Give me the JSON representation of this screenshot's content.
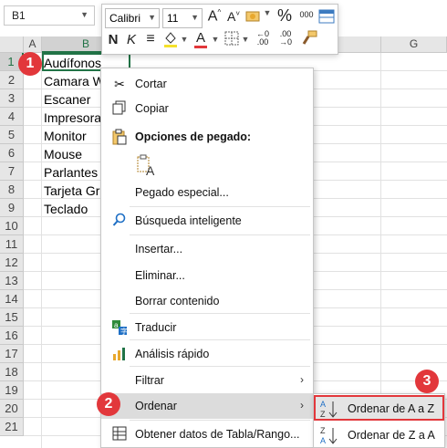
{
  "name_box": {
    "value": "B1"
  },
  "columns": [
    {
      "label": "A",
      "selected": false
    },
    {
      "label": "B",
      "selected": true
    },
    {
      "label": "G",
      "selected": false
    }
  ],
  "rows": [
    "1",
    "2",
    "3",
    "4",
    "5",
    "6",
    "7",
    "8",
    "9",
    "10",
    "11",
    "12",
    "13",
    "14",
    "15",
    "16",
    "17",
    "18",
    "19",
    "20",
    "21"
  ],
  "cells": [
    "Audífonos",
    "Camara W",
    "Escaner",
    "Impresora",
    "Monitor",
    "Mouse",
    "Parlantes",
    "Tarjeta Gr",
    "Teclado"
  ],
  "mini_toolbar": {
    "font_name": "Calibri",
    "font_size": "11",
    "bold": "N",
    "italic": "K",
    "percent": "%",
    "thousands": "000"
  },
  "context_menu": {
    "items": [
      {
        "label": "Cortar",
        "icon": "scissors-icon"
      },
      {
        "label": "Copiar",
        "icon": "copy-icon"
      },
      {
        "label": "Opciones de pegado:",
        "icon": "paste-icon"
      },
      {
        "label": "Pegado especial...",
        "icon": ""
      },
      {
        "label": "Búsqueda inteligente",
        "icon": "smart-lookup-icon"
      },
      {
        "label": "Insertar...",
        "icon": ""
      },
      {
        "label": "Eliminar...",
        "icon": ""
      },
      {
        "label": "Borrar contenido",
        "icon": ""
      },
      {
        "label": "Traducir",
        "icon": "translate-icon"
      },
      {
        "label": "Análisis rápido",
        "icon": "quick-analysis-icon"
      },
      {
        "label": "Filtrar",
        "icon": ""
      },
      {
        "label": "Ordenar",
        "icon": ""
      },
      {
        "label": "Obtener datos de Tabla/Rango...",
        "icon": "table-icon"
      }
    ]
  },
  "sort_submenu": {
    "items": [
      {
        "label": "Ordenar de A a Z",
        "icon": "sort-a-z-icon"
      },
      {
        "label": "Ordenar de Z a A",
        "icon": "sort-z-a-icon"
      }
    ]
  },
  "badges": [
    "1",
    "2",
    "3"
  ],
  "colors": {
    "accent": "#217346",
    "badge": "#e2373b",
    "menu_hover": "#dcdcdc"
  }
}
